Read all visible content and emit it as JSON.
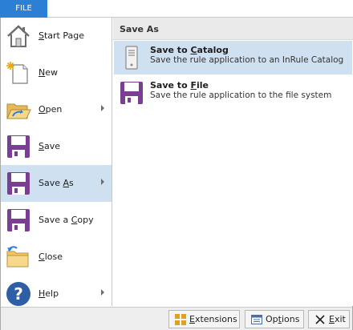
{
  "file_tab": {
    "label": "FILE"
  },
  "menu": {
    "items": [
      {
        "id": "start-page",
        "label": "Start Page",
        "mnemonic_index": 0,
        "has_arrow": false,
        "icon": "house-icon"
      },
      {
        "id": "new",
        "label": "New",
        "mnemonic_index": 0,
        "has_arrow": false,
        "icon": "new-document-icon"
      },
      {
        "id": "open",
        "label": "Open",
        "mnemonic_index": 0,
        "has_arrow": true,
        "icon": "open-folder-icon"
      },
      {
        "id": "save",
        "label": "Save",
        "mnemonic_index": 0,
        "has_arrow": false,
        "icon": "floppy-disk-icon"
      },
      {
        "id": "save-as",
        "label": "Save As",
        "mnemonic_index": 5,
        "has_arrow": true,
        "icon": "save-as-icon",
        "selected": true
      },
      {
        "id": "save-copy",
        "label": "Save a Copy",
        "mnemonic_index": 7,
        "has_arrow": false,
        "icon": "save-copy-icon"
      },
      {
        "id": "close",
        "label": "Close",
        "mnemonic_index": 0,
        "has_arrow": false,
        "icon": "close-folder-icon"
      },
      {
        "id": "help",
        "label": "Help",
        "mnemonic_index": 0,
        "has_arrow": true,
        "icon": "help-icon"
      }
    ]
  },
  "panel": {
    "title": "Save As",
    "options": [
      {
        "id": "save-to-catalog",
        "title_prefix": "Save to ",
        "title_key": "C",
        "title_suffix": "atalog",
        "description": "Save the rule application to an InRule Catalog",
        "icon": "server-icon",
        "highlighted": true
      },
      {
        "id": "save-to-file",
        "title_prefix": "Save to ",
        "title_key": "F",
        "title_suffix": "ile",
        "description": "Save the rule application to the file system",
        "icon": "floppy-disk-icon",
        "highlighted": false
      }
    ]
  },
  "footer": {
    "extensions": {
      "prefix": "",
      "key": "E",
      "suffix": "xtensions"
    },
    "options": {
      "prefix": "Op",
      "key": "t",
      "suffix": "ions"
    },
    "exit": {
      "prefix": "",
      "key": "E",
      "suffix": "xit"
    }
  },
  "colors": {
    "accent": "#2b7fd4",
    "selection": "#cfe0f1",
    "floppy": "#7a3f92"
  }
}
